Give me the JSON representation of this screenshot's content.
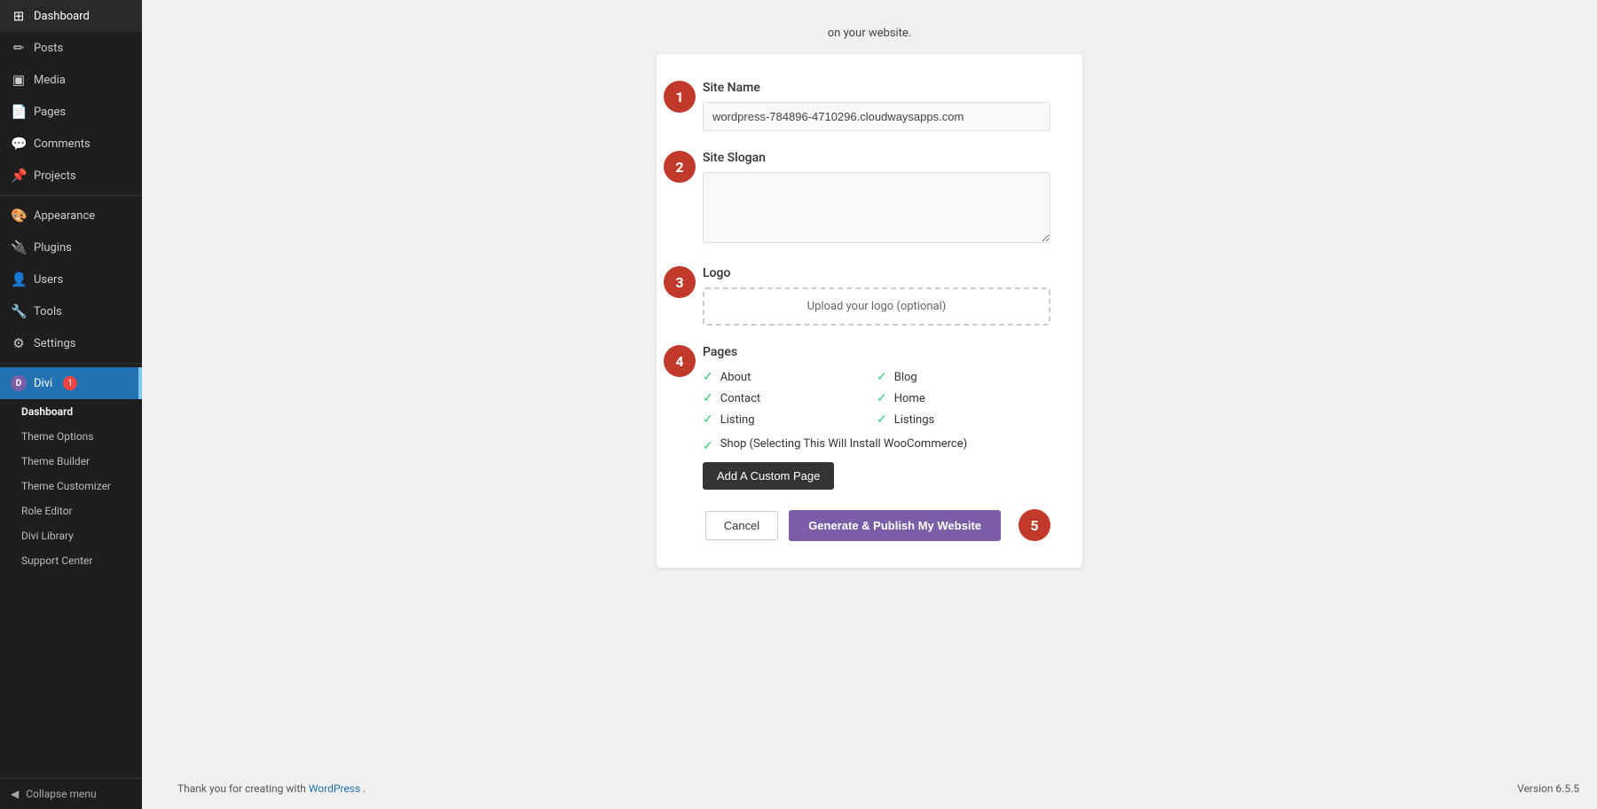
{
  "sidebar": {
    "items": [
      {
        "id": "dashboard",
        "label": "Dashboard",
        "icon": "⊞"
      },
      {
        "id": "posts",
        "label": "Posts",
        "icon": "✏"
      },
      {
        "id": "media",
        "label": "Media",
        "icon": "⬛"
      },
      {
        "id": "pages",
        "label": "Pages",
        "icon": "📄"
      },
      {
        "id": "comments",
        "label": "Comments",
        "icon": "💬"
      },
      {
        "id": "projects",
        "label": "Projects",
        "icon": "📌"
      },
      {
        "id": "appearance",
        "label": "Appearance",
        "icon": "🎨"
      },
      {
        "id": "plugins",
        "label": "Plugins",
        "icon": "🔌"
      },
      {
        "id": "users",
        "label": "Users",
        "icon": "👤"
      },
      {
        "id": "tools",
        "label": "Tools",
        "icon": "🔧"
      },
      {
        "id": "settings",
        "label": "Settings",
        "icon": "⚙"
      }
    ],
    "divi": {
      "label": "Divi",
      "badge": "1",
      "subitems": [
        "Dashboard",
        "Theme Options",
        "Theme Builder",
        "Theme Customizer",
        "Role Editor",
        "Divi Library",
        "Support Center"
      ]
    },
    "collapse": "Collapse menu"
  },
  "main": {
    "top_hint": "on your website.",
    "steps": [
      {
        "number": "1",
        "label": "Site Name",
        "input_value": "wordpress-784896-4710296.cloudwaysapps.com",
        "input_placeholder": ""
      },
      {
        "number": "2",
        "label": "Site Slogan",
        "input_placeholder": ""
      },
      {
        "number": "3",
        "label": "Logo",
        "upload_label": "Upload your logo (optional)"
      },
      {
        "number": "4",
        "label": "Pages",
        "pages_left": [
          {
            "label": "About",
            "checked": true
          },
          {
            "label": "Contact",
            "checked": true
          },
          {
            "label": "Listing",
            "checked": true
          }
        ],
        "pages_right": [
          {
            "label": "Blog",
            "checked": true
          },
          {
            "label": "Home",
            "checked": true
          },
          {
            "label": "Listings",
            "checked": true
          }
        ],
        "pages_wide": [
          {
            "label": "Shop (Selecting This Will Install WooCommerce)",
            "checked": true
          }
        ],
        "add_page_btn": "Add A Custom Page"
      }
    ],
    "step5_number": "5",
    "cancel_btn": "Cancel",
    "publish_btn": "Generate & Publish My Website"
  },
  "footer": {
    "note_prefix": "Thank you for creating with ",
    "note_link": "WordPress",
    "note_suffix": ".",
    "version": "Version 6.5.5"
  }
}
